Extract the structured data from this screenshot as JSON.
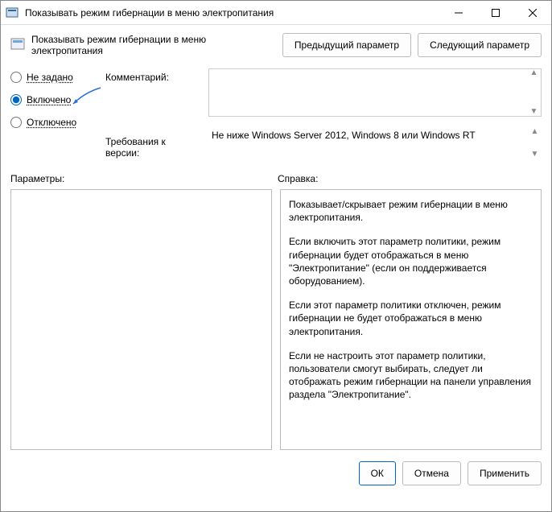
{
  "window": {
    "title": "Показывать режим гибернации в меню электропитания"
  },
  "subheader": {
    "title": "Показывать режим гибернации в меню электропитания",
    "prev_btn": "Предыдущий параметр",
    "next_btn": "Следующий параметр"
  },
  "radios": {
    "not_configured": "Не задано",
    "enabled": "Включено",
    "disabled": "Отключено"
  },
  "labels": {
    "comment": "Комментарий:",
    "requirements": "Требования к версии:",
    "parameters": "Параметры:",
    "help": "Справка:"
  },
  "requirements_text": "Не ниже Windows Server 2012, Windows 8 или Windows RT",
  "help": {
    "p1": "Показывает/скрывает режим гибернации в меню электропитания.",
    "p2": "Если включить этот параметр политики, режим гибернации будет отображаться в меню \"Электропитание\" (если он поддерживается оборудованием).",
    "p3": "Если этот параметр политики отключен, режим гибернации не будет отображаться в меню электропитания.",
    "p4": "Если не настроить этот параметр политики, пользователи смогут выбирать, следует ли отображать режим гибернации на панели управления раздела \"Электропитание\"."
  },
  "footer": {
    "ok": "ОК",
    "cancel": "Отмена",
    "apply": "Применить"
  }
}
